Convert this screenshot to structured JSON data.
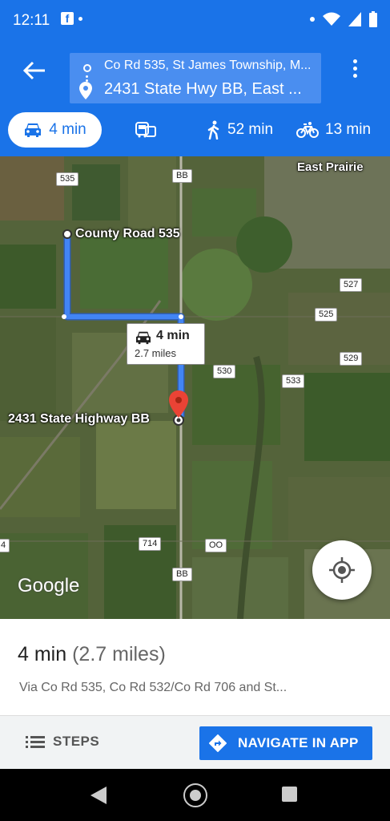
{
  "status": {
    "time": "12:11",
    "fb": "f"
  },
  "header": {
    "origin": "Co Rd 535, St James Township, M...",
    "destination": "2431 State Hwy BB, East ...",
    "modes": [
      {
        "name": "drive",
        "label": "4 min"
      },
      {
        "name": "transit",
        "label": ""
      },
      {
        "name": "walk",
        "label": "52 min"
      },
      {
        "name": "bike",
        "label": "13 min"
      }
    ]
  },
  "map": {
    "shields": [
      "535",
      "BB",
      "527",
      "525",
      "530",
      "533",
      "529",
      "714",
      "OO",
      "BB",
      "4"
    ],
    "place_east_prairie": "East Prairie",
    "start_label": "County Road 535",
    "end_label": "2431 State Highway BB",
    "callout_time": "4 min",
    "callout_distance": "2.7 miles",
    "watermark": "Google"
  },
  "summary": {
    "duration": "4 min",
    "distance": "(2.7 miles)",
    "via": "Via Co Rd 535, Co Rd 532/Co Rd 706 and St..."
  },
  "actions": {
    "steps": "STEPS",
    "navigate": "NAVIGATE IN APP"
  },
  "colors": {
    "accent": "#1a73e8",
    "route": "#4285f4",
    "pin": "#ea4335"
  }
}
